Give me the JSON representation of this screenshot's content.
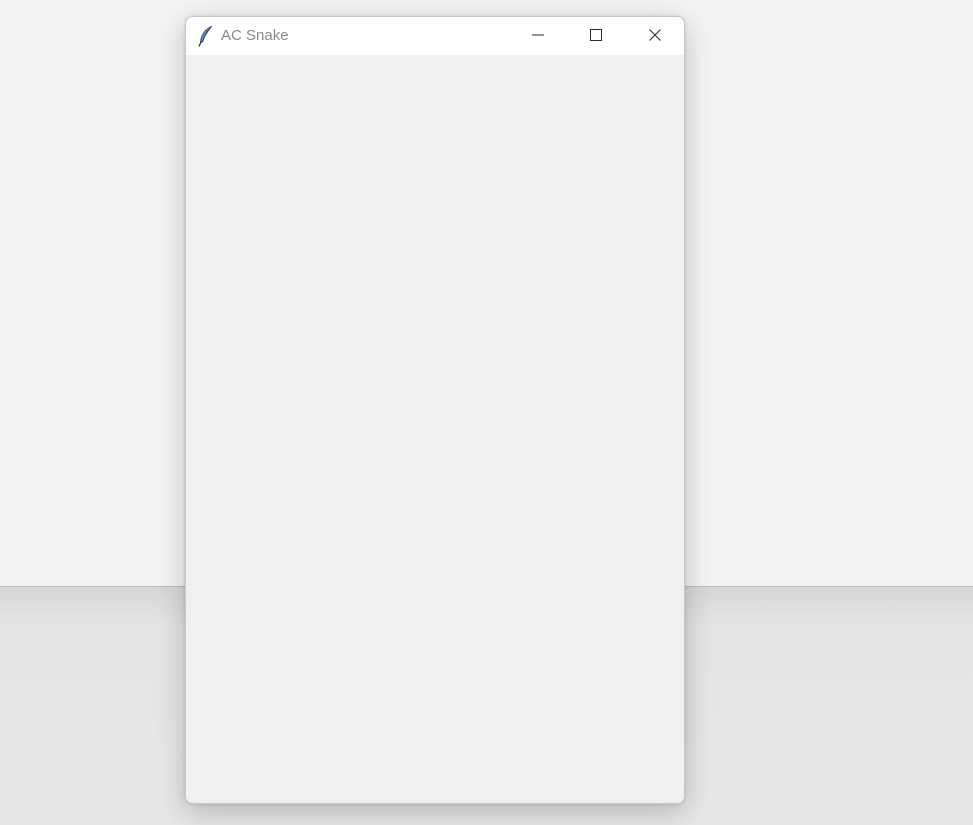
{
  "window": {
    "title": "AC Snake",
    "app_icon": "feather-icon",
    "controls": {
      "minimize_icon": "minimize-icon",
      "maximize_icon": "maximize-icon",
      "close_icon": "close-icon"
    }
  },
  "colors": {
    "desktop_top": "#f3f3f3",
    "desktop_bottom": "#e6e7e9",
    "titlebar": "#ffffff",
    "window_client": "#f0f0f0",
    "title_text": "#8a8a8a"
  }
}
